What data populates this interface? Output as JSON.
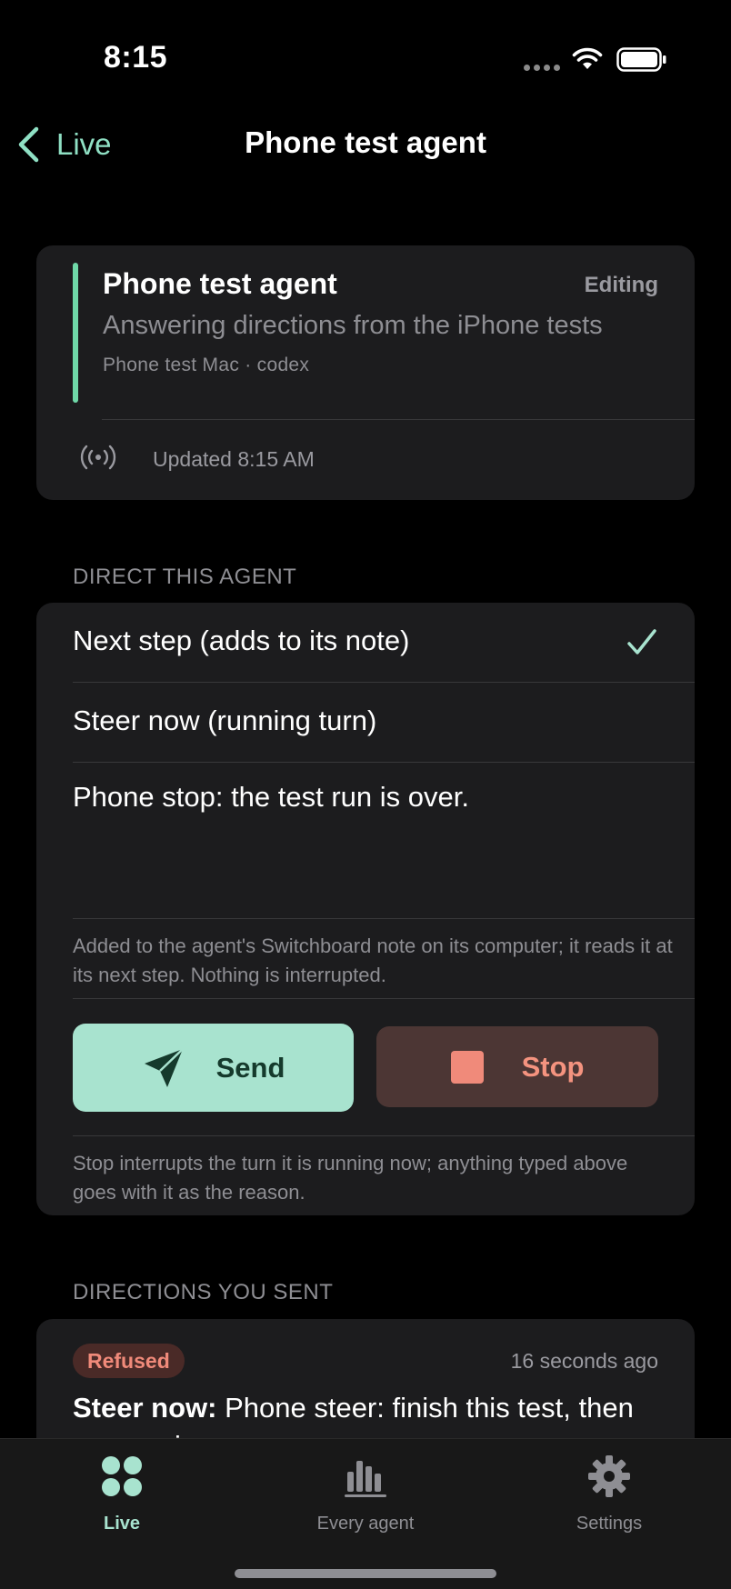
{
  "status_bar": {
    "time": "8:15"
  },
  "nav": {
    "back_label": "Live",
    "title": "Phone test agent"
  },
  "agent": {
    "name": "Phone test agent",
    "status": "Editing",
    "description": "Answering directions from the iPhone tests",
    "meta": "Phone test Mac · codex",
    "updated": "Updated 8:15 AM",
    "accent_color": "#6fd8a8"
  },
  "direct": {
    "header": "DIRECT THIS AGENT",
    "options": [
      {
        "label": "Next step (adds to its note)",
        "selected": true
      },
      {
        "label": "Steer now (running turn)",
        "selected": false
      }
    ],
    "message": "Phone stop: the test run is over.",
    "hint": "Added to the agent's Switchboard note on its computer; it reads it at its next step. Nothing is interrupted.",
    "send_label": "Send",
    "stop_label": "Stop",
    "stop_hint": "Stop interrupts the turn it is running now; anything typed above goes with it as the reason."
  },
  "directions": {
    "header": "DIRECTIONS YOU SENT",
    "items": [
      {
        "status": "Refused",
        "time_ago": "16 seconds ago",
        "kind": "Steer now:",
        "text": " Phone steer: finish this test, then summarize."
      }
    ]
  },
  "tabs": [
    {
      "label": "Live",
      "icon": "four-dots-icon",
      "active": true
    },
    {
      "label": "Every agent",
      "icon": "bar-chart-icon",
      "active": false
    },
    {
      "label": "Settings",
      "icon": "gear-icon",
      "active": false
    }
  ],
  "colors": {
    "accent": "#a8e3cf",
    "send_button": "#a8e3cf",
    "stop_button": "#4c3634",
    "refused": "#f08a7a"
  }
}
